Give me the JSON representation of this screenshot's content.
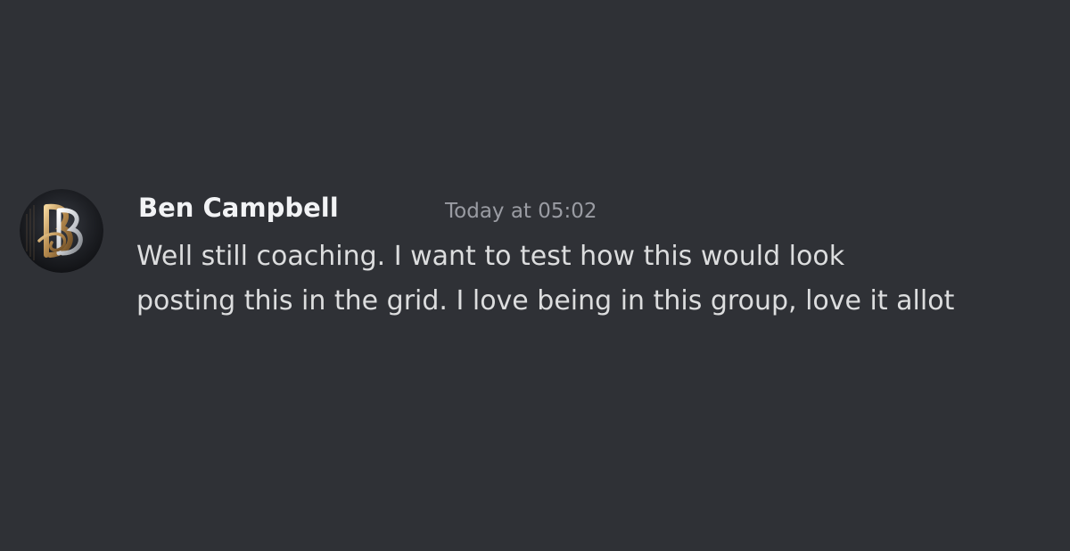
{
  "message": {
    "author": "Ben Campbell",
    "timestamp": "Today at 05:02",
    "lines": [
      "Well still coaching. I want to test how this would look",
      "posting this in the grid. I love being in this group, love it allot"
    ],
    "avatar_icon": "monogram-bb-icon"
  },
  "colors": {
    "background": "#2f3136",
    "author": "#f2f3f5",
    "timestamp": "#9a9ca3",
    "text": "#dcddde"
  }
}
